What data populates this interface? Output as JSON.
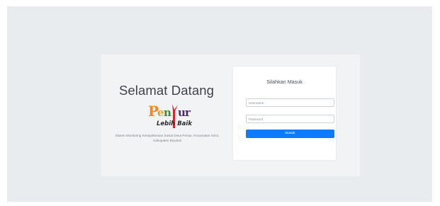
{
  "welcome": {
    "title": "Selamat Datang",
    "logo": {
      "text": "Pentur",
      "tagline": "Lebih Baik"
    },
    "description": "Sistem Monitoring Kesejahteraan Sosial Desa Pentur, Kecamatan Simo, Kabupaten Boyolali"
  },
  "login": {
    "title": "Silahkan Masuk",
    "username_placeholder": "Username",
    "password_placeholder": "Password",
    "submit_label": "Masuk"
  },
  "colors": {
    "page_background": "#e9ecef",
    "panel_background": "#f2f3f4",
    "primary": "#0d7bff",
    "logo_orange": "#f08a1c",
    "logo_red": "#d7262c",
    "logo_purple": "#4b2a73"
  }
}
